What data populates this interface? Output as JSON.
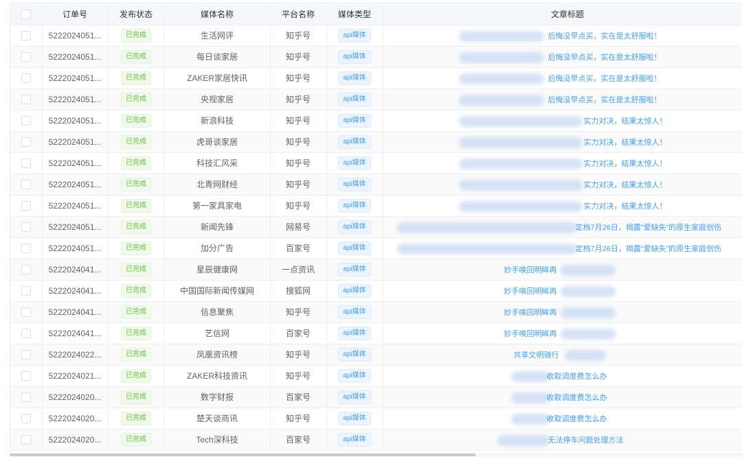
{
  "table": {
    "headers": {
      "order_no": "订单号",
      "status": "发布状态",
      "media_name": "媒体名称",
      "platform": "平台名称",
      "media_type": "媒体类型",
      "article_title": "文章标题"
    },
    "rows": [
      {
        "order_no": "5222024051...",
        "status": "已完成",
        "media_name": "生活网评",
        "platform": "知乎号",
        "media_type": "api媒体",
        "title": "后悔没早点买，实在是太舒服啦！"
      },
      {
        "order_no": "5222024051...",
        "status": "已完成",
        "media_name": "每日谈家居",
        "platform": "知乎号",
        "media_type": "api媒体",
        "title": "后悔没早点买，实在是太舒服啦！"
      },
      {
        "order_no": "5222024051...",
        "status": "已完成",
        "media_name": "ZAKER家居快讯",
        "platform": "知乎号",
        "media_type": "api媒体",
        "title": "后悔没早点买，实在是太舒服啦！"
      },
      {
        "order_no": "5222024051...",
        "status": "已完成",
        "media_name": "央视家居",
        "platform": "知乎号",
        "media_type": "api媒体",
        "title": "后悔没早点买，实在是太舒服啦！"
      },
      {
        "order_no": "5222024051...",
        "status": "已完成",
        "media_name": "新浪科技",
        "platform": "知乎号",
        "media_type": "api媒体",
        "title": "实力对决，结果太惊人！"
      },
      {
        "order_no": "5222024051...",
        "status": "已完成",
        "media_name": "虎哥谈家居",
        "platform": "知乎号",
        "media_type": "api媒体",
        "title": "实力对决，结果太惊人！"
      },
      {
        "order_no": "5222024051...",
        "status": "已完成",
        "media_name": "科技汇风采",
        "platform": "知乎号",
        "media_type": "api媒体",
        "title": "实力对决，结果太惊人！"
      },
      {
        "order_no": "5222024051...",
        "status": "已完成",
        "media_name": "北青网财经",
        "platform": "知乎号",
        "media_type": "api媒体",
        "title": "实力对决，结果太惊人！"
      },
      {
        "order_no": "5222024051...",
        "status": "已完成",
        "media_name": "第一家具家电",
        "platform": "知乎号",
        "media_type": "api媒体",
        "title": "实力对决，结果太惊人！"
      },
      {
        "order_no": "5222024051...",
        "status": "已完成",
        "media_name": "新闻先锋",
        "platform": "网易号",
        "media_type": "api媒体",
        "title": "定档7月26日，揭露“爱缺失”的原生家庭创伤"
      },
      {
        "order_no": "5222024051...",
        "status": "已完成",
        "media_name": "加分广告",
        "platform": "百家号",
        "media_type": "api媒体",
        "title": "定档7月26日，揭露“爱缺失”的原生家庭创伤"
      },
      {
        "order_no": "5222024041...",
        "status": "已完成",
        "media_name": "星辰健康网",
        "platform": "一点资讯",
        "media_type": "api媒体",
        "title": "妙手唤回明眸再"
      },
      {
        "order_no": "5222024041...",
        "status": "已完成",
        "media_name": "中国国际新闻传媒网",
        "platform": "搜狐网",
        "media_type": "api媒体",
        "title": "妙手唤回明眸再"
      },
      {
        "order_no": "5222024041...",
        "status": "已完成",
        "media_name": "信息聚焦",
        "platform": "知乎号",
        "media_type": "api媒体",
        "title": "妙手唤回明眸再"
      },
      {
        "order_no": "5222024041...",
        "status": "已完成",
        "media_name": "艺信网",
        "platform": "百家号",
        "media_type": "api媒体",
        "title": "妙手唤回明眸再"
      },
      {
        "order_no": "5222024022...",
        "status": "已完成",
        "media_name": "凤凰资讯榜",
        "platform": "知乎号",
        "media_type": "api媒体",
        "title": "共享文明骑行"
      },
      {
        "order_no": "5222024021...",
        "status": "已完成",
        "media_name": "ZAKER科技资讯",
        "platform": "知乎号",
        "media_type": "api媒体",
        "title": "收取调度费怎么办"
      },
      {
        "order_no": "5222024020...",
        "status": "已完成",
        "media_name": "数字财报",
        "platform": "百家号",
        "media_type": "api媒体",
        "title": "收取调度费怎么办"
      },
      {
        "order_no": "5222024020...",
        "status": "已完成",
        "media_name": "楚天谈商讯",
        "platform": "知乎号",
        "media_type": "api媒体",
        "title": "收取调度费怎么办"
      },
      {
        "order_no": "5222024020...",
        "status": "已完成",
        "media_name": "Tech深科技",
        "platform": "百家号",
        "media_type": "api媒体",
        "title": "无法停车问题处理方法"
      }
    ]
  },
  "colors": {
    "status_green": "#67c23a",
    "link_blue": "#409eff",
    "header_bg": "#f5f7fa",
    "border": "#ebeef5"
  }
}
